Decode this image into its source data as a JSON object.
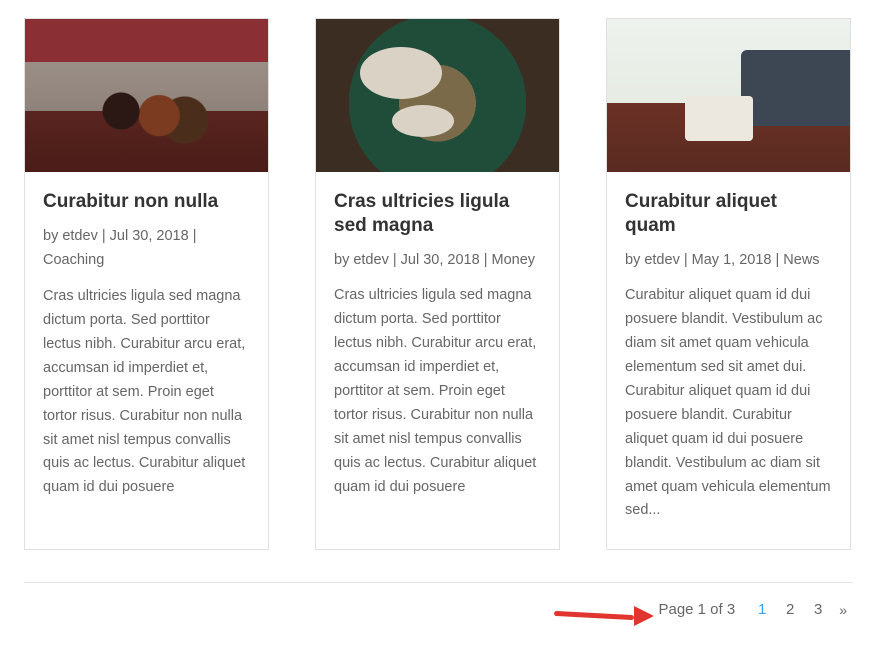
{
  "posts": [
    {
      "title": "Curabitur non nulla",
      "author": "etdev",
      "date": "Jul 30, 2018",
      "category": "Coaching",
      "excerpt": "Cras ultricies ligula sed magna dictum porta. Sed porttitor lectus nibh. Curabitur arcu erat, accumsan id imperdiet et, porttitor at sem. Proin eget tortor risus. Curabitur non nulla sit amet nisl tempus convallis quis ac lectus. Curabitur aliquet quam id dui posuere"
    },
    {
      "title": "Cras ultricies ligula sed magna",
      "author": "etdev",
      "date": "Jul 30, 2018",
      "category": "Money",
      "excerpt": "Cras ultricies ligula sed magna dictum porta. Sed porttitor lectus nibh. Curabitur arcu erat, accumsan id imperdiet et, porttitor at sem. Proin eget tortor risus. Curabitur non nulla sit amet nisl tempus convallis quis ac lectus. Curabitur aliquet quam id dui posuere"
    },
    {
      "title": "Curabitur aliquet quam",
      "author": "etdev",
      "date": "May 1, 2018",
      "category": "News",
      "excerpt": "Curabitur aliquet quam id dui posuere blandit. Vestibulum ac diam sit amet quam vehicula elementum sed sit amet dui. Curabitur aliquet quam id dui posuere blandit. Curabitur aliquet quam id dui posuere blandit. Vestibulum ac diam sit amet quam vehicula elementum sed..."
    }
  ],
  "meta_by": "by ",
  "meta_sep": " | ",
  "pagination": {
    "info": "Page 1 of 3",
    "pages": [
      "1",
      "2",
      "3"
    ],
    "current": "1",
    "next": "»"
  }
}
